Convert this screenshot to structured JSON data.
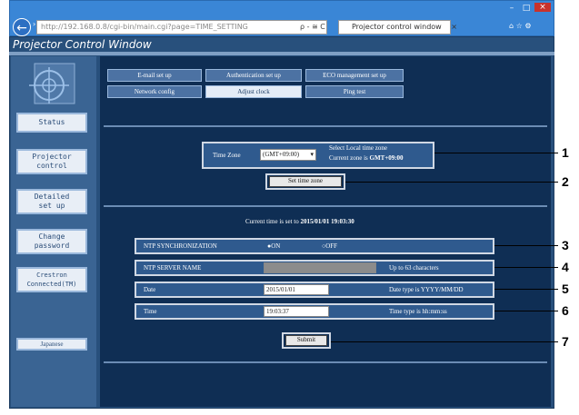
{
  "browser": {
    "address": "http://192.168.0.8/cgi-bin/main.cgi?page=TIME_SETTING",
    "tab_title": "Projector control window",
    "tab_close": "×",
    "window_controls": [
      "–",
      "□",
      "×"
    ],
    "nav_search": "ρ - ≅ C",
    "toolbar_icons": "⌂ ☆ ⚙"
  },
  "app": {
    "title": "Projector Control Window"
  },
  "sidebar": {
    "items": [
      "Status",
      "Projector\ncontrol",
      "Detailed\nset up",
      "Change\npassword",
      "Crestron\nConnected(TM)"
    ],
    "language_button": "Japanese"
  },
  "tabs": {
    "row1": [
      "E-mail set up",
      "Authentication set up",
      "ECO management set up"
    ],
    "row2": [
      "Network config",
      "Adjust clock",
      "Ping test"
    ],
    "active": "Adjust clock"
  },
  "timezone": {
    "label": "Time Zone",
    "value": "(GMT+09:00)",
    "hint_line1": "Select Local time zone",
    "hint_line2_prefix": "Current zone is ",
    "hint_line2_value": "GMT+09:00",
    "button": "Set time zone"
  },
  "clock": {
    "current_prefix": "Current time is set to ",
    "current_value": "2015/01/01 19:03:30"
  },
  "ntp": {
    "sync_label": "NTP SYNCHRONIZATION",
    "on_label": "ON",
    "off_label": "OFF",
    "selected": "ON",
    "server_label": "NTP SERVER NAME",
    "server_value": "",
    "server_hint": "Up to 63 characters"
  },
  "date": {
    "label": "Date",
    "value": "2015/01/01",
    "hint": "Date type is YYYY/MM/DD"
  },
  "time": {
    "label": "Time",
    "value": "19:03:37",
    "hint": "Time type is hh:mm:ss"
  },
  "submit": "Submit",
  "callouts": [
    "1",
    "2",
    "3",
    "4",
    "5",
    "6",
    "7"
  ]
}
